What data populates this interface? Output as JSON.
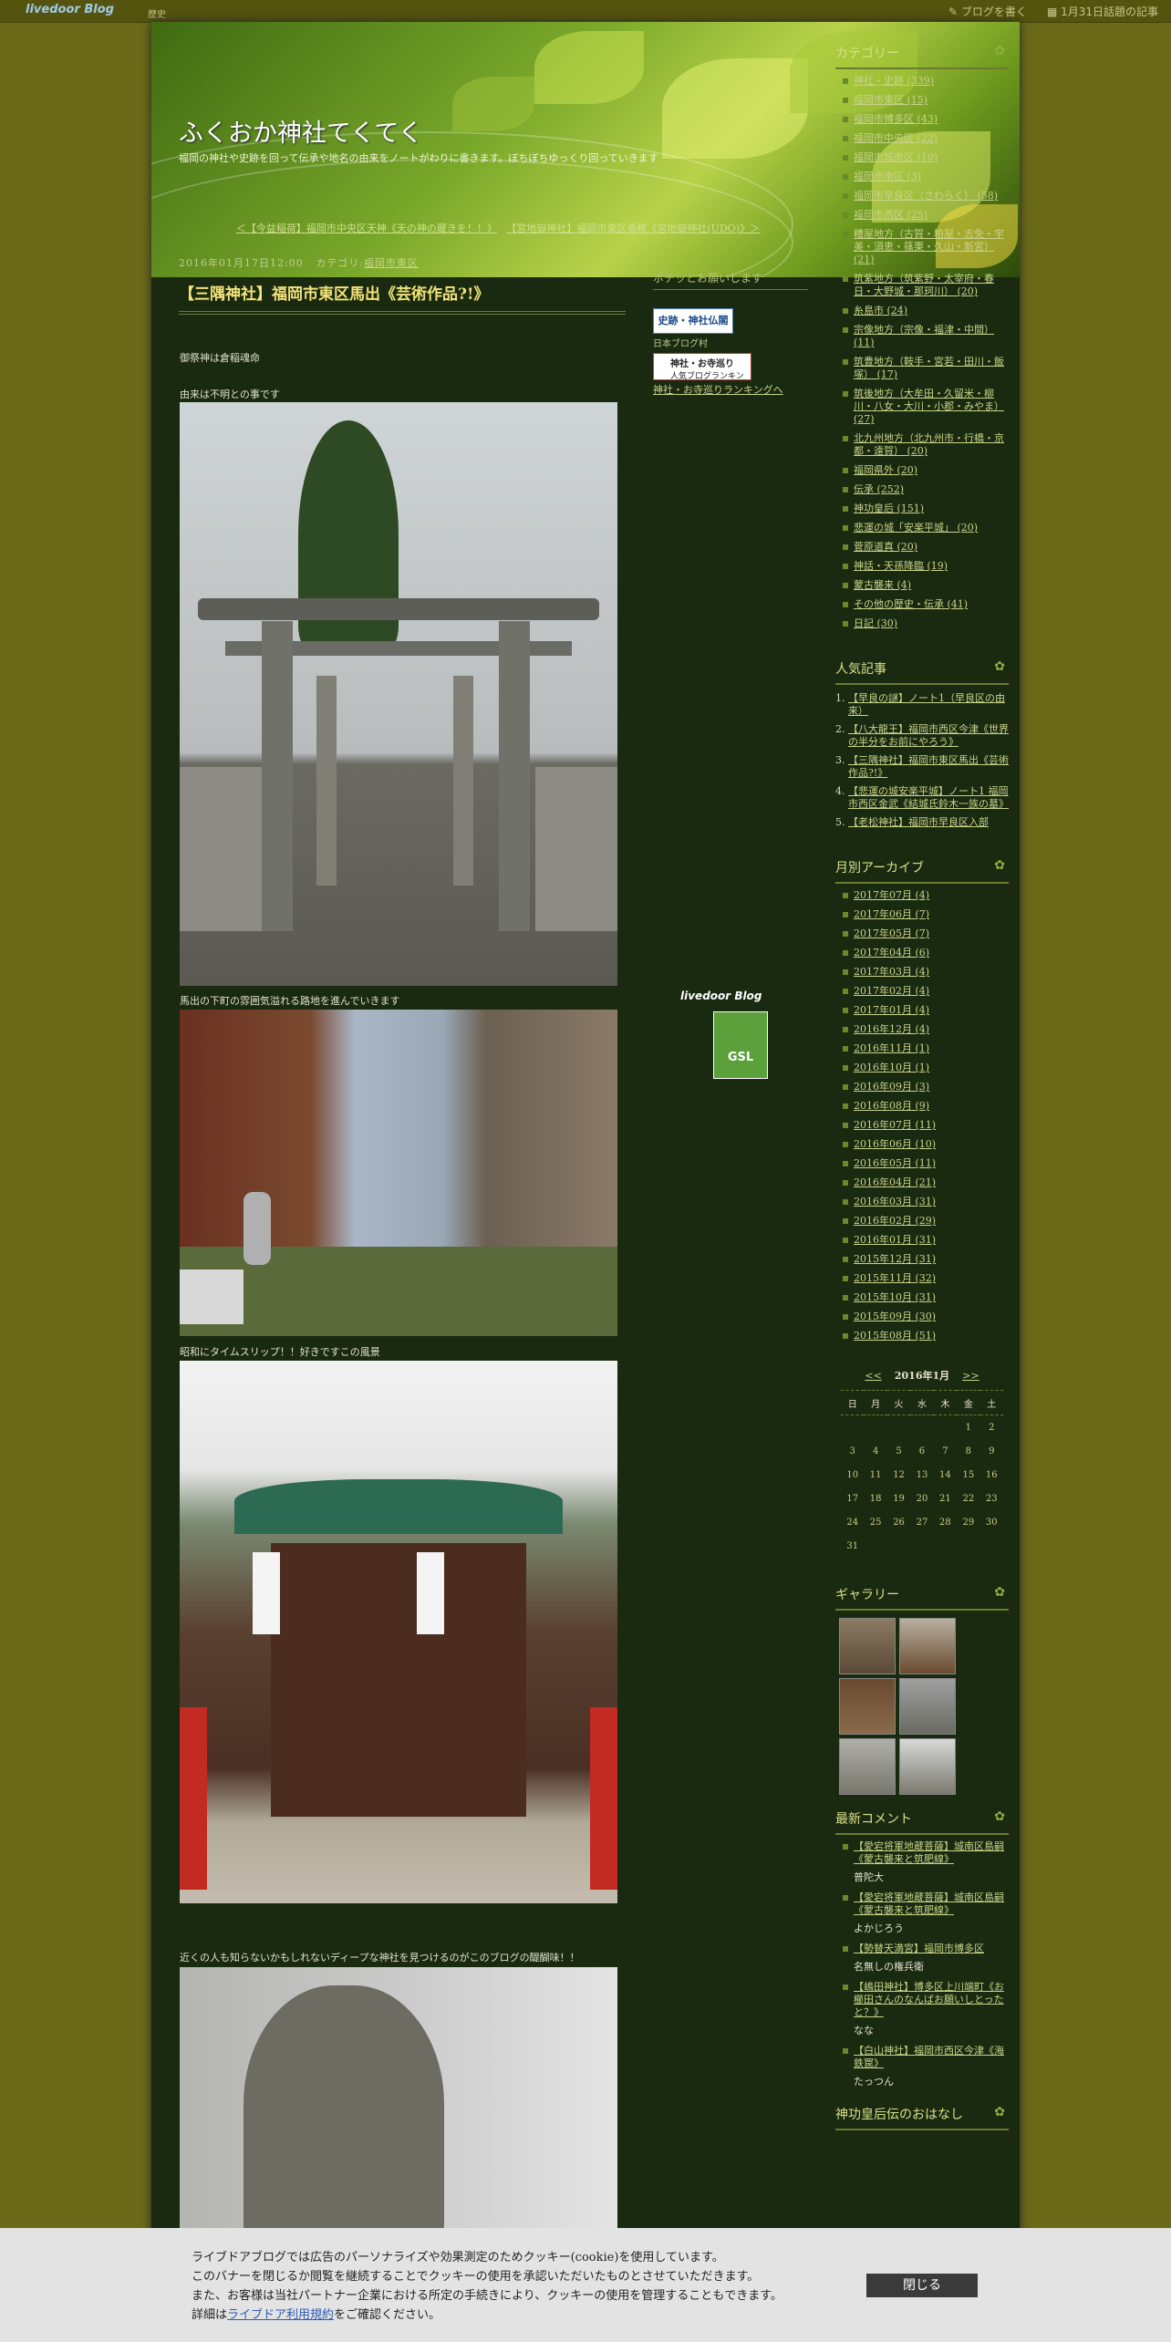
{
  "topbar": {
    "logo": "livedoor",
    "logo_blog": "Blog",
    "history": "歴史",
    "write": "ブログを書く",
    "hot": "1月31日話題の記事"
  },
  "header": {
    "title": "ふくおか神社てくてく",
    "description": "福岡の神社や史跡を回って伝承や地名の由来をノートがわりに書きます。ぼちぼちゆっくり回っていきます",
    "prev": "＜【今益稲荷】福岡市中央区天神《天の神の蔵きを！！》",
    "next": "【宮地嶽神社】福岡市東区香椎《宮地嶽神社(UDO)》＞"
  },
  "post": {
    "date": "2016年01月17日12:00",
    "category_label": "カテゴリ",
    "category": "福岡市東区",
    "title": "【三隅神社】福岡市東区馬出《芸術作品?!》",
    "line1": "御祭神は倉稲魂命",
    "line2": "由来は不明との事です",
    "caption1": "馬出の下町の雰囲気溢れる路地を進んでいきます",
    "caption2": "昭和にタイムスリップ！！好きですこの風景",
    "caption3": "近くの人も知らないかもしれないディープな神社を見つけるのがこのブログの醍醐味！！"
  },
  "mid": {
    "title": "ポチッとお願いします",
    "banner1": "史跡・神社仏閣",
    "banner1_sub": "日本ブログ村",
    "banner2": "神社・お寺巡り",
    "banner2_sub": "人気ブログランキング",
    "rank_link": "神社・お寺巡りランキングへ",
    "footer_logo": "livedoor Blog",
    "gsl": "GSL"
  },
  "categories_title": "カテゴリー",
  "categories": [
    "神社・史跡 (339)",
    "福岡市東区 (15)",
    "福岡市博多区 (43)",
    "福岡市中央区 (22)",
    "福岡市城南区 (10)",
    "福岡市南区 (3)",
    "福岡市早良区（さわらく） (58)",
    "福岡市西区 (25)",
    "糟屋地方（古賀・粕屋・志免・宇美・須恵・篠栗・久山・新宮） (21)",
    "筑紫地方（筑紫野・太宰府・春日・大野城・那珂川） (20)",
    "糸島市 (24)",
    "宗像地方（宗像・福津・中間） (11)",
    "筑豊地方（鞍手・宮若・田川・飯塚） (17)",
    "筑後地方（大牟田・久留米・柳川・八女・大川・小郡・みやま） (27)",
    "北九州地方（北九州市・行橋・京都・遠賀） (20)",
    "福岡県外 (20)",
    "伝承 (252)",
    "神功皇后 (151)",
    "悲運の城「安楽平城」 (20)",
    "菅原道真 (20)",
    "神話・天孫降臨 (19)",
    "蒙古襲来 (4)",
    "その他の歴史・伝承 (41)",
    "日記 (30)"
  ],
  "popular_title": "人気記事",
  "popular": [
    "【早良の謎】ノート1（早良区の由来）",
    "【八大龍王】福岡市西区今津《世界の半分をお前にやろう》",
    "【三隅神社】福岡市東区馬出《芸術作品?!》",
    "【悲運の城安楽平城】ノート1 福岡市西区金武《結城氏鈴木一族の墓》",
    "【老松神社】福岡市早良区入部"
  ],
  "archive_title": "月別アーカイブ",
  "archives": [
    "2017年07月 (4)",
    "2017年06月 (7)",
    "2017年05月 (7)",
    "2017年04月 (6)",
    "2017年03月 (4)",
    "2017年02月 (4)",
    "2017年01月 (4)",
    "2016年12月 (4)",
    "2016年11月 (1)",
    "2016年10月 (1)",
    "2016年09月 (3)",
    "2016年08月 (9)",
    "2016年07月 (11)",
    "2016年06月 (10)",
    "2016年05月 (11)",
    "2016年04月 (21)",
    "2016年03月 (31)",
    "2016年02月 (29)",
    "2016年01月 (31)",
    "2015年12月 (31)",
    "2015年11月 (32)",
    "2015年10月 (31)",
    "2015年09月 (30)",
    "2015年08月 (51)"
  ],
  "calendar": {
    "prev": "<<",
    "title": "2016年1月",
    "next": ">>",
    "days": [
      "日",
      "月",
      "火",
      "水",
      "木",
      "金",
      "土"
    ],
    "weeks": [
      [
        "",
        "",
        "",
        "",
        "",
        "1",
        "2"
      ],
      [
        "3",
        "4",
        "5",
        "6",
        "7",
        "8",
        "9"
      ],
      [
        "10",
        "11",
        "12",
        "13",
        "14",
        "15",
        "16"
      ],
      [
        "17",
        "18",
        "19",
        "20",
        "21",
        "22",
        "23"
      ],
      [
        "24",
        "25",
        "26",
        "27",
        "28",
        "29",
        "30"
      ],
      [
        "31",
        "",
        "",
        "",
        "",
        "",
        ""
      ]
    ]
  },
  "gallery_title": "ギャラリー",
  "comments_title": "最新コメント",
  "comments": [
    {
      "link": "【愛宕将軍地蔵菩薩】城南区島嗣《蒙古襲来と筑肥線》",
      "author": "普陀大"
    },
    {
      "link": "【愛宕将軍地蔵菩薩】城南区島嗣《蒙古襲来と筑肥線》",
      "author": "よかじろう"
    },
    {
      "link": "【勢替天満宮】福岡市博多区",
      "author": "名無しの権兵衛"
    },
    {
      "link": "【嶋田神社】博多区上川端町《お櫛田さんのなんばお願いしとったと？》",
      "author": "なな"
    },
    {
      "link": "【白山神社】福岡市西区今津《海鉄罠》",
      "author": "たっつん"
    }
  ],
  "bottom_title": "神功皇后伝のおはなし",
  "cookie": {
    "line1": "ライブドアブログでは広告のパーソナライズや効果測定のためクッキー(cookie)を使用しています。",
    "line2": "このバナーを閉じるか閲覧を継続することでクッキーの使用を承認いただいたものとさせていただきます。",
    "line3": "また、お客様は当社パートナー企業における所定の手続きにより、クッキーの使用を管理することもできます。",
    "line4_pre": "詳細は",
    "line4_link": "ライブドア利用規約",
    "line4_post": "をご確認ください。",
    "close": "閉じる"
  }
}
